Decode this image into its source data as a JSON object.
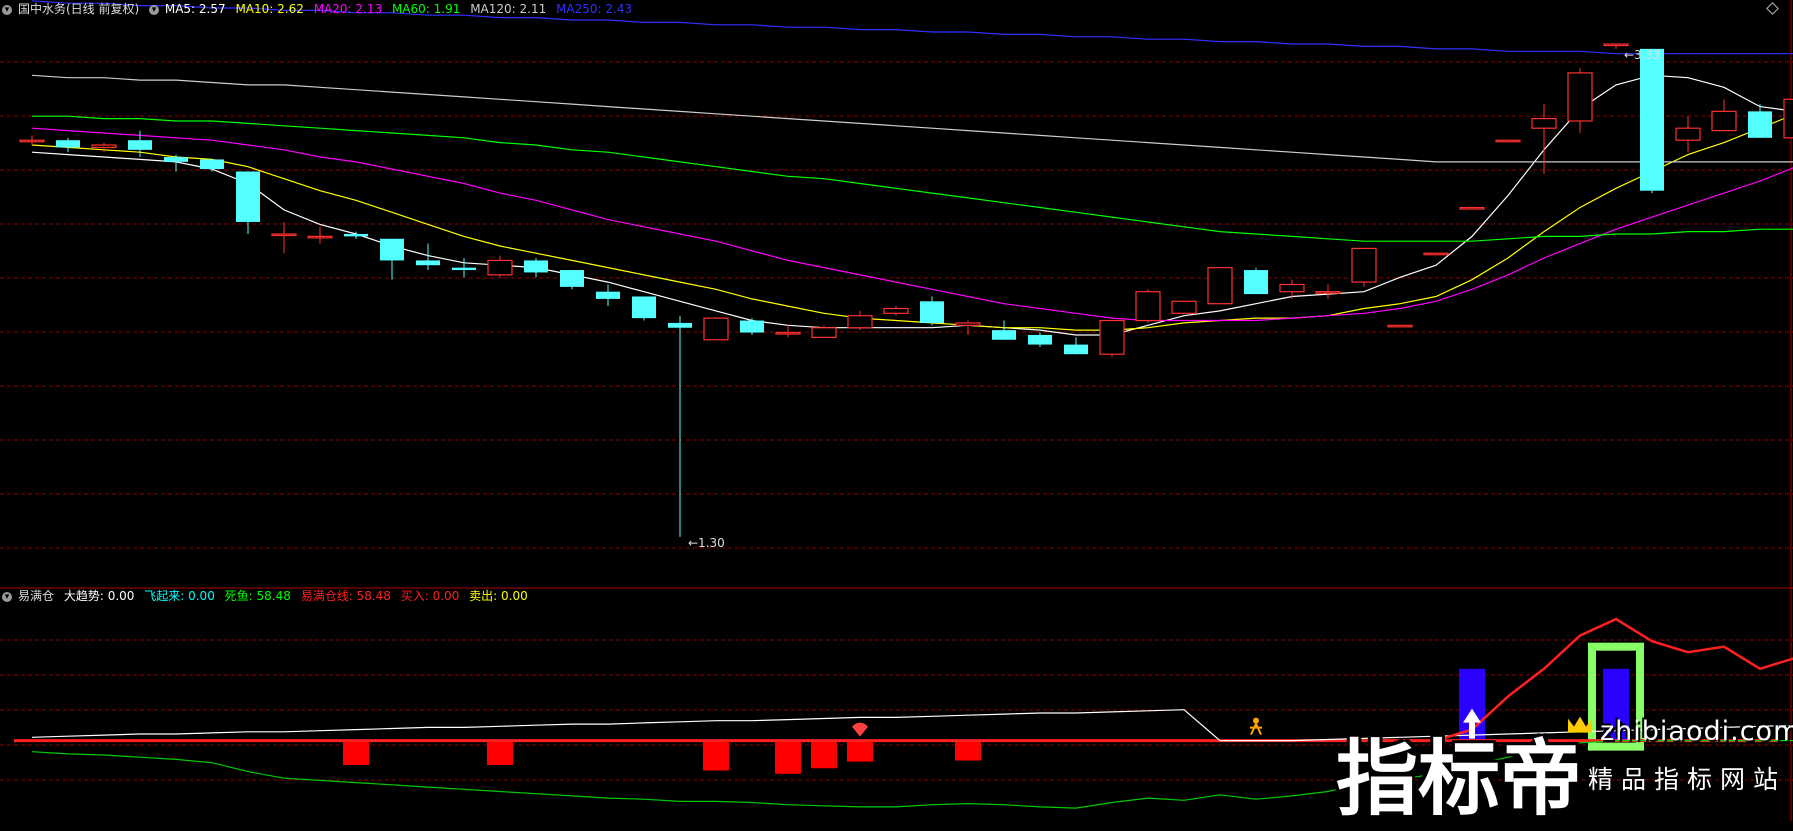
{
  "main_header": {
    "title": "国中水务(日线 前复权)",
    "items": [
      {
        "label": "MA5: 2.57",
        "color": "#ffffff"
      },
      {
        "label": "MA10: 2.62",
        "color": "#ffff00"
      },
      {
        "label": "MA20: 2.13",
        "color": "#ff00ff"
      },
      {
        "label": "MA60: 1.91",
        "color": "#00ff00"
      },
      {
        "label": "MA120: 2.11",
        "color": "#cccccc"
      },
      {
        "label": "MA250: 2.43",
        "color": "#3030ff"
      }
    ]
  },
  "sub_header": {
    "title": "易满仓",
    "items": [
      {
        "label": "大趋势: 0.00",
        "color": "#ffffff"
      },
      {
        "label": "飞起来: 0.00",
        "color": "#00ffff"
      },
      {
        "label": "死鱼: 58.48",
        "color": "#00ff00"
      },
      {
        "label": "易满仓线: 58.48",
        "color": "#ff2020"
      },
      {
        "label": "买入: 0.00",
        "color": "#ff2020"
      },
      {
        "label": "卖出: 0.00",
        "color": "#ffff00"
      }
    ]
  },
  "colors": {
    "up": "#ff3030",
    "down": "#54ffff",
    "grid": "#8b0000",
    "background": "#000000"
  },
  "watermark": {
    "cn": "指标帝",
    "en": "zhibiaodi.com",
    "sub": "精品指标网站"
  },
  "chart_data": [
    {
      "type": "candlestick",
      "title": "国中水务(日线 前复权)",
      "ylim": [
        1.1,
        3.45
      ],
      "annotations": [
        {
          "label": "1.30",
          "index": 18,
          "value": 1.3
        },
        {
          "label": "3.33",
          "index": 44,
          "value": 3.33
        }
      ],
      "candles": [
        [
          2.95,
          2.97,
          2.93,
          2.95
        ],
        [
          2.95,
          2.96,
          2.9,
          2.92
        ],
        [
          2.92,
          2.94,
          2.9,
          2.93
        ],
        [
          2.95,
          2.99,
          2.88,
          2.91
        ],
        [
          2.88,
          2.89,
          2.82,
          2.86
        ],
        [
          2.87,
          2.87,
          2.82,
          2.83
        ],
        [
          2.82,
          2.82,
          2.56,
          2.61
        ],
        [
          2.56,
          2.61,
          2.48,
          2.56
        ],
        [
          2.55,
          2.59,
          2.52,
          2.55
        ],
        [
          2.56,
          2.57,
          2.54,
          2.55
        ],
        [
          2.54,
          2.54,
          2.37,
          2.45
        ],
        [
          2.45,
          2.52,
          2.41,
          2.43
        ],
        [
          2.42,
          2.46,
          2.38,
          2.41
        ],
        [
          2.39,
          2.47,
          2.38,
          2.45
        ],
        [
          2.45,
          2.46,
          2.38,
          2.4
        ],
        [
          2.41,
          2.41,
          2.33,
          2.34
        ],
        [
          2.32,
          2.35,
          2.26,
          2.29
        ],
        [
          2.3,
          2.3,
          2.2,
          2.21
        ],
        [
          2.19,
          2.22,
          1.3,
          2.17
        ],
        [
          2.12,
          2.21,
          2.12,
          2.21
        ],
        [
          2.2,
          2.21,
          2.14,
          2.15
        ],
        [
          2.15,
          2.18,
          2.13,
          2.15
        ],
        [
          2.13,
          2.18,
          2.13,
          2.17
        ],
        [
          2.17,
          2.24,
          2.16,
          2.22
        ],
        [
          2.23,
          2.26,
          2.22,
          2.25
        ],
        [
          2.28,
          2.3,
          2.18,
          2.19
        ],
        [
          2.18,
          2.2,
          2.14,
          2.19
        ],
        [
          2.16,
          2.2,
          2.12,
          2.12
        ],
        [
          2.14,
          2.15,
          2.09,
          2.1
        ],
        [
          2.1,
          2.13,
          2.06,
          2.06
        ],
        [
          2.06,
          2.2,
          2.05,
          2.2
        ],
        [
          2.2,
          2.33,
          2.19,
          2.32
        ],
        [
          2.23,
          2.28,
          2.23,
          2.28
        ],
        [
          2.27,
          2.42,
          2.27,
          2.42
        ],
        [
          2.41,
          2.42,
          2.31,
          2.31
        ],
        [
          2.32,
          2.37,
          2.29,
          2.35
        ],
        [
          2.32,
          2.35,
          2.29,
          2.32
        ],
        [
          2.36,
          2.5,
          2.34,
          2.5
        ],
        [
          2.18,
          2.18,
          2.18,
          2.18
        ],
        [
          2.48,
          2.48,
          2.48,
          2.48
        ],
        [
          2.67,
          2.67,
          2.67,
          2.67
        ],
        [
          2.95,
          2.95,
          2.95,
          2.95
        ],
        [
          3.0,
          3.1,
          2.81,
          3.04
        ],
        [
          3.03,
          3.25,
          2.98,
          3.23
        ],
        [
          3.35,
          3.35,
          3.33,
          3.35
        ],
        [
          3.33,
          3.33,
          2.73,
          2.74
        ],
        [
          2.95,
          3.05,
          2.9,
          3.0
        ],
        [
          2.99,
          3.12,
          2.99,
          3.07
        ],
        [
          3.07,
          3.1,
          2.96,
          2.96
        ],
        [
          2.96,
          3.18,
          2.96,
          3.12
        ],
        [
          3.1,
          3.29,
          3.01,
          3.22
        ]
      ],
      "series": [
        {
          "name": "MA5",
          "color": "#ffffff",
          "values": [
            2.9,
            2.89,
            2.88,
            2.87,
            2.86,
            2.83,
            2.77,
            2.66,
            2.6,
            2.56,
            2.51,
            2.47,
            2.44,
            2.43,
            2.42,
            2.39,
            2.36,
            2.32,
            2.28,
            2.24,
            2.2,
            2.18,
            2.17,
            2.17,
            2.17,
            2.17,
            2.18,
            2.17,
            2.16,
            2.14,
            2.14,
            2.18,
            2.22,
            2.24,
            2.27,
            2.3,
            2.31,
            2.32,
            2.38,
            2.43,
            2.55,
            2.72,
            2.91,
            3.08,
            3.18,
            3.22,
            3.21,
            3.17,
            3.09,
            3.07,
            3.07
          ]
        },
        {
          "name": "MA10",
          "color": "#ffff00",
          "values": [
            2.93,
            2.92,
            2.91,
            2.9,
            2.88,
            2.87,
            2.84,
            2.79,
            2.74,
            2.7,
            2.65,
            2.6,
            2.55,
            2.51,
            2.48,
            2.45,
            2.42,
            2.39,
            2.36,
            2.33,
            2.29,
            2.26,
            2.23,
            2.21,
            2.2,
            2.19,
            2.18,
            2.17,
            2.17,
            2.16,
            2.16,
            2.17,
            2.19,
            2.2,
            2.21,
            2.21,
            2.22,
            2.25,
            2.27,
            2.3,
            2.37,
            2.46,
            2.57,
            2.67,
            2.75,
            2.82,
            2.89,
            2.94,
            3.0,
            3.06,
            3.11
          ]
        },
        {
          "name": "MA20",
          "color": "#ff00ff",
          "values": [
            3.0,
            2.99,
            2.98,
            2.97,
            2.96,
            2.95,
            2.93,
            2.91,
            2.88,
            2.86,
            2.83,
            2.8,
            2.77,
            2.73,
            2.7,
            2.66,
            2.62,
            2.59,
            2.56,
            2.53,
            2.49,
            2.45,
            2.42,
            2.39,
            2.36,
            2.33,
            2.3,
            2.27,
            2.25,
            2.23,
            2.21,
            2.2,
            2.2,
            2.2,
            2.2,
            2.21,
            2.22,
            2.23,
            2.25,
            2.28,
            2.33,
            2.39,
            2.46,
            2.52,
            2.58,
            2.63,
            2.68,
            2.73,
            2.78,
            2.84,
            2.9
          ]
        },
        {
          "name": "MA60",
          "color": "#00ff00",
          "values": [
            3.05,
            3.05,
            3.04,
            3.04,
            3.03,
            3.03,
            3.02,
            3.01,
            3.0,
            2.99,
            2.98,
            2.97,
            2.96,
            2.94,
            2.93,
            2.91,
            2.9,
            2.88,
            2.86,
            2.84,
            2.82,
            2.8,
            2.79,
            2.77,
            2.75,
            2.73,
            2.71,
            2.69,
            2.67,
            2.65,
            2.63,
            2.61,
            2.59,
            2.57,
            2.56,
            2.55,
            2.54,
            2.53,
            2.53,
            2.53,
            2.53,
            2.54,
            2.55,
            2.55,
            2.56,
            2.56,
            2.57,
            2.57,
            2.58,
            2.58,
            2.59
          ]
        },
        {
          "name": "MA120",
          "color": "#cccccc",
          "values": [
            3.22,
            3.21,
            3.21,
            3.2,
            3.2,
            3.19,
            3.18,
            3.18,
            3.17,
            3.16,
            3.15,
            3.14,
            3.13,
            3.12,
            3.11,
            3.1,
            3.09,
            3.08,
            3.07,
            3.06,
            3.05,
            3.04,
            3.03,
            3.02,
            3.01,
            3.0,
            2.99,
            2.98,
            2.97,
            2.96,
            2.95,
            2.94,
            2.93,
            2.92,
            2.91,
            2.9,
            2.89,
            2.88,
            2.87,
            2.86,
            2.86,
            2.86,
            2.86,
            2.86,
            2.86,
            2.86,
            2.86,
            2.86,
            2.86,
            2.86,
            2.86
          ]
        },
        {
          "name": "MA250",
          "color": "#3030ff",
          "values": [
            3.53,
            3.52,
            3.52,
            3.51,
            3.51,
            3.5,
            3.5,
            3.49,
            3.49,
            3.48,
            3.48,
            3.47,
            3.47,
            3.46,
            3.46,
            3.45,
            3.45,
            3.44,
            3.44,
            3.43,
            3.43,
            3.42,
            3.42,
            3.41,
            3.41,
            3.4,
            3.4,
            3.39,
            3.39,
            3.38,
            3.38,
            3.37,
            3.37,
            3.36,
            3.36,
            3.35,
            3.35,
            3.34,
            3.34,
            3.33,
            3.33,
            3.32,
            3.32,
            3.32,
            3.31,
            3.31,
            3.31,
            3.31,
            3.31,
            3.31,
            3.31
          ]
        }
      ]
    },
    {
      "type": "indicator",
      "title": "易满仓",
      "ylim": [
        -70,
        120
      ],
      "zero_line": 0,
      "series": [
        {
          "name": "大趋势",
          "color": "#ffffff",
          "values": [
            3,
            4,
            5,
            6,
            6,
            7,
            8,
            8,
            9,
            10,
            11,
            12,
            12,
            13,
            14,
            15,
            15,
            16,
            17,
            18,
            18,
            19,
            20,
            21,
            21,
            22,
            23,
            24,
            25,
            25,
            26,
            27,
            28,
            0,
            0,
            0,
            1,
            2,
            3,
            4,
            5,
            6,
            7,
            8,
            9,
            10,
            11,
            12,
            13,
            14,
            0
          ]
        },
        {
          "name": "死鱼",
          "color": "#00cc00",
          "values": [
            -10,
            -12,
            -13,
            -15,
            -17,
            -20,
            -28,
            -34,
            -36,
            -38,
            -40,
            -42,
            -44,
            -46,
            -48,
            -50,
            -52,
            -53,
            -55,
            -55,
            -56,
            -58,
            -59,
            -60,
            -60,
            -58,
            -57,
            -58,
            -60,
            -61,
            -56,
            -52,
            -54,
            -49,
            -53,
            -50,
            -46,
            -38,
            -35,
            -30,
            -22,
            -15,
            -8,
            -2,
            0,
            0,
            0,
            0,
            0,
            0,
            0
          ]
        },
        {
          "name": "易满仓线",
          "color": "#ff2020",
          "values": [
            null,
            null,
            null,
            null,
            null,
            null,
            null,
            null,
            null,
            null,
            null,
            null,
            null,
            null,
            null,
            null,
            null,
            null,
            null,
            null,
            null,
            null,
            null,
            null,
            null,
            null,
            null,
            null,
            null,
            null,
            null,
            null,
            null,
            null,
            null,
            null,
            null,
            0,
            0,
            0,
            10,
            40,
            65,
            95,
            110,
            90,
            80,
            85,
            65,
            75,
            78
          ]
        }
      ],
      "bars": [
        {
          "index": 9,
          "value": -22,
          "color": "#ff0000"
        },
        {
          "index": 13,
          "value": -22,
          "color": "#ff0000"
        },
        {
          "index": 19,
          "value": -27,
          "color": "#ff0000"
        },
        {
          "index": 21,
          "value": -30,
          "color": "#ff0000"
        },
        {
          "index": 22,
          "value": -25,
          "color": "#ff0000"
        },
        {
          "index": 23,
          "value": -19,
          "color": "#ff0000"
        },
        {
          "index": 26,
          "value": -18,
          "color": "#ff0000"
        },
        {
          "index": 40,
          "value": 65,
          "color": "#2b00ff"
        },
        {
          "index": 44,
          "value": 65,
          "color": "#2b00ff"
        }
      ],
      "highlight_box": {
        "index": 44,
        "value": 85,
        "color": "#88ff66"
      },
      "signals": [
        {
          "index": 23,
          "type": "sell-marker"
        },
        {
          "index": 34,
          "type": "runner-marker"
        },
        {
          "index": 40,
          "type": "buy-arrow"
        },
        {
          "index": 43,
          "type": "crown-marker"
        }
      ]
    }
  ]
}
